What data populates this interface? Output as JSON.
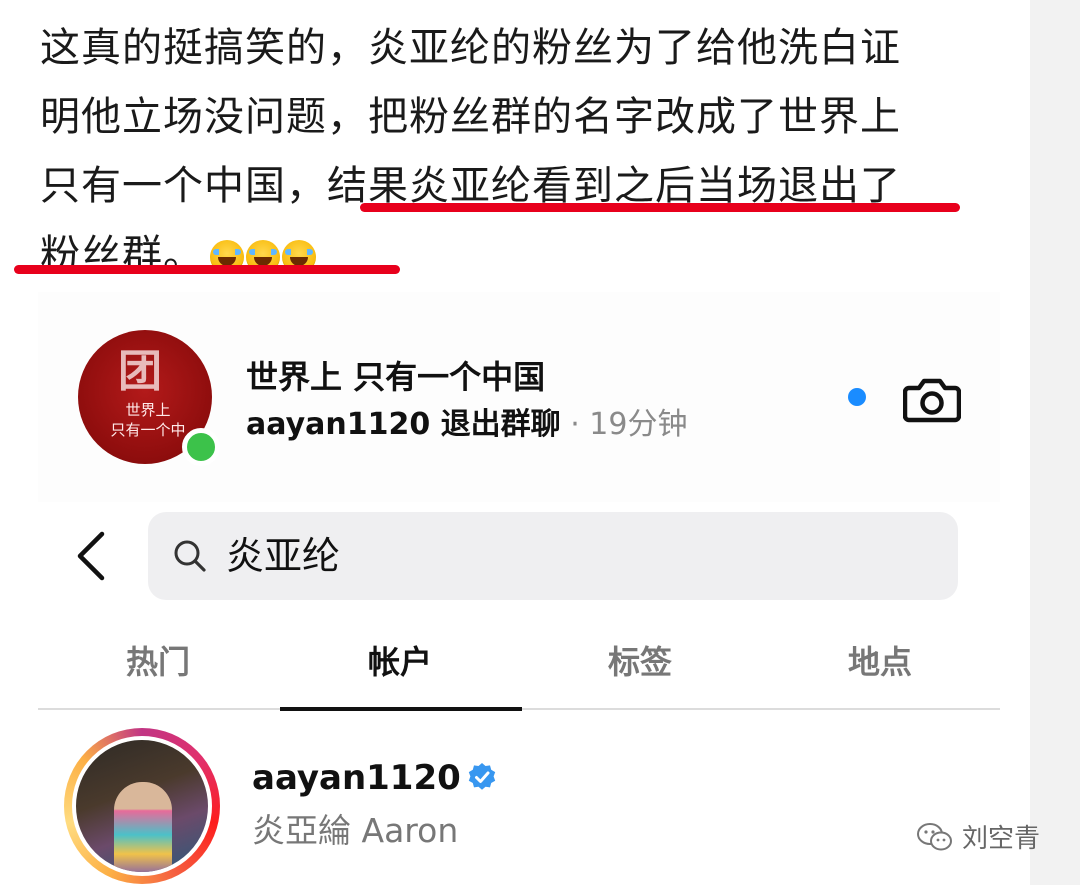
{
  "post": {
    "line1": "这真的挺搞笑的，炎亚纶的粉丝为了给他洗白证",
    "line2": "明他立场没问题，把粉丝群的名字改成了世界上",
    "line3": "只有一个中国，结果炎亚纶看到之后当场退出了",
    "line4": "粉丝群。",
    "emoji": "laughing-with-tears-icon",
    "underline_color": "#e8001c"
  },
  "group_chat": {
    "avatar_seal": "团",
    "avatar_text_line1": "世界上",
    "avatar_text_line2": "只有一个中",
    "name": "世界上 只有一个中国",
    "status": "aayan1120 退出群聊",
    "time": " · 19分钟",
    "online_color": "#3cc24a",
    "unread_color": "#1a8cff"
  },
  "search": {
    "query": "炎亚纶"
  },
  "tabs": [
    {
      "label": "热门"
    },
    {
      "label": "帐户"
    },
    {
      "label": "标签"
    },
    {
      "label": "地点"
    }
  ],
  "active_tab": "帐户",
  "account": {
    "username": "aayan1120",
    "full_name": "炎亞綸 Aaron",
    "verified": true
  },
  "watermark": {
    "text": "刘空青"
  }
}
